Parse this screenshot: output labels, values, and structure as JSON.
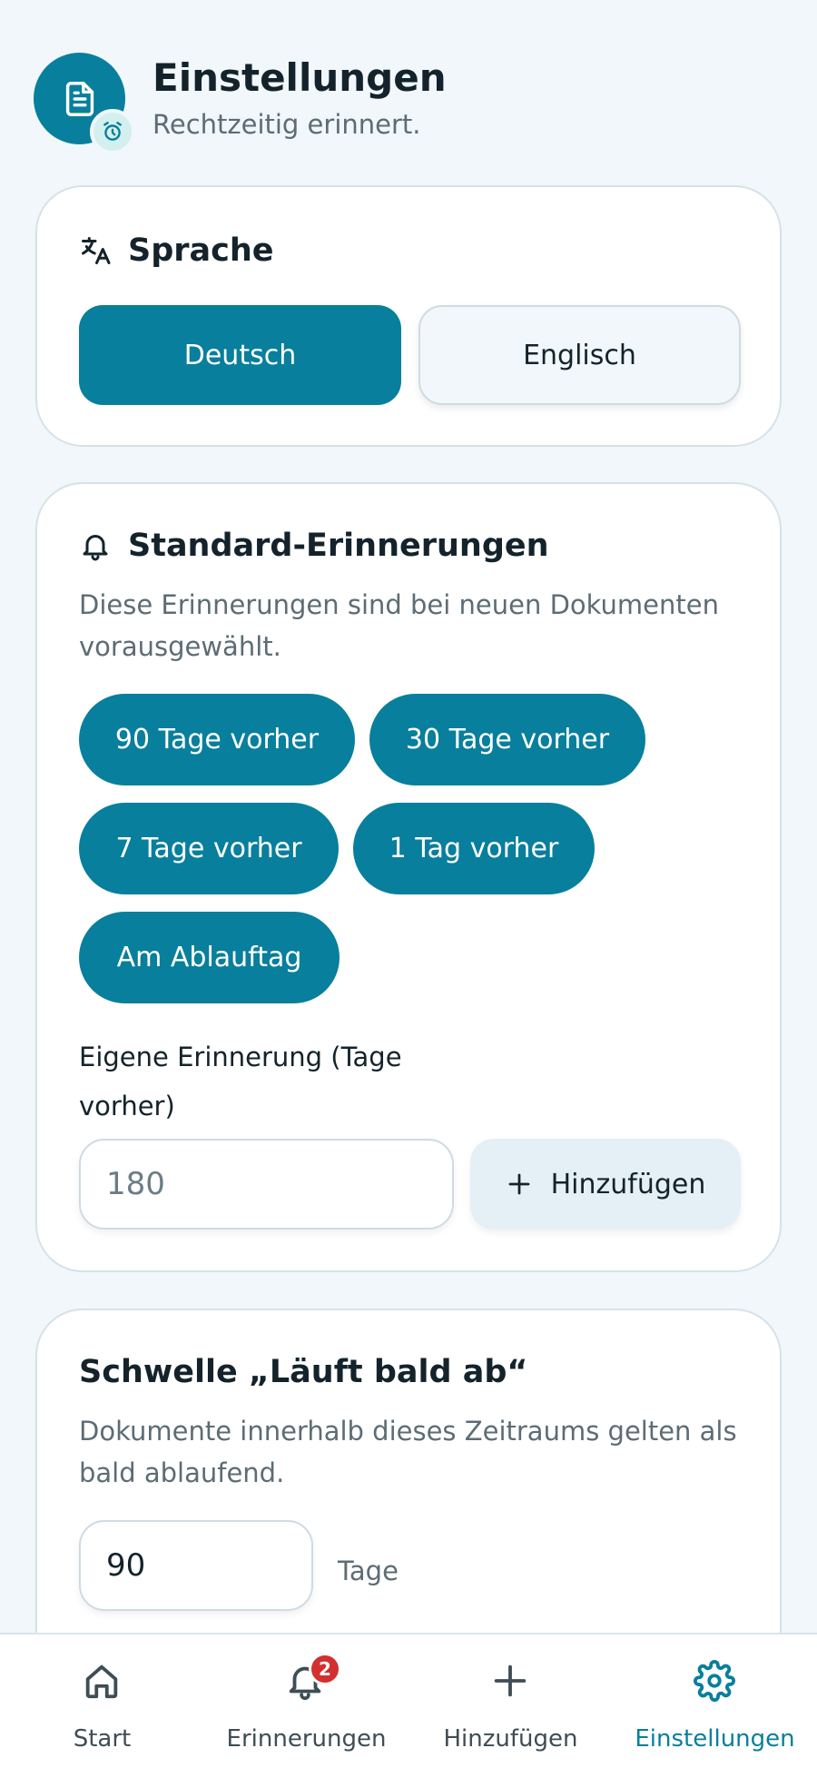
{
  "colors": {
    "primary": "#087f9c",
    "background": "#f1f7fa",
    "card": "#ffffff",
    "badge": "#d32f2f"
  },
  "header": {
    "title": "Einstellungen",
    "subtitle": "Rechtzeitig erinnert.",
    "logo_icon": "document-icon",
    "badge_icon": "alarm-clock-icon"
  },
  "language": {
    "title": "Sprache",
    "icon": "translate-icon",
    "options": [
      {
        "label": "Deutsch",
        "selected": true
      },
      {
        "label": "Englisch",
        "selected": false
      }
    ]
  },
  "reminders": {
    "title": "Standard-Erinnerungen",
    "icon": "bell-icon",
    "description": "Diese Erinnerungen sind bei neuen Dokumenten vorausgewählt.",
    "chips": [
      "90 Tage vorher",
      "30 Tage vorher",
      "7 Tage vorher",
      "1 Tag vorher",
      "Am Ablauftag"
    ],
    "custom_label": "Eigene Erinnerung (Tage vorher)",
    "custom_placeholder": "180",
    "add_label": "Hinzufügen"
  },
  "threshold": {
    "title": "Schwelle „Läuft bald ab“",
    "description": "Dokumente innerhalb dieses Zeitraums gelten als bald ablaufend.",
    "value": "90",
    "unit": "Tage"
  },
  "nav": {
    "items": [
      {
        "label": "Start",
        "icon": "home-icon",
        "active": false
      },
      {
        "label": "Erinnerungen",
        "icon": "bell-icon",
        "active": false,
        "badge": "2"
      },
      {
        "label": "Hinzufügen",
        "icon": "plus-icon",
        "active": false
      },
      {
        "label": "Einstellungen",
        "icon": "gear-icon",
        "active": true
      }
    ]
  }
}
